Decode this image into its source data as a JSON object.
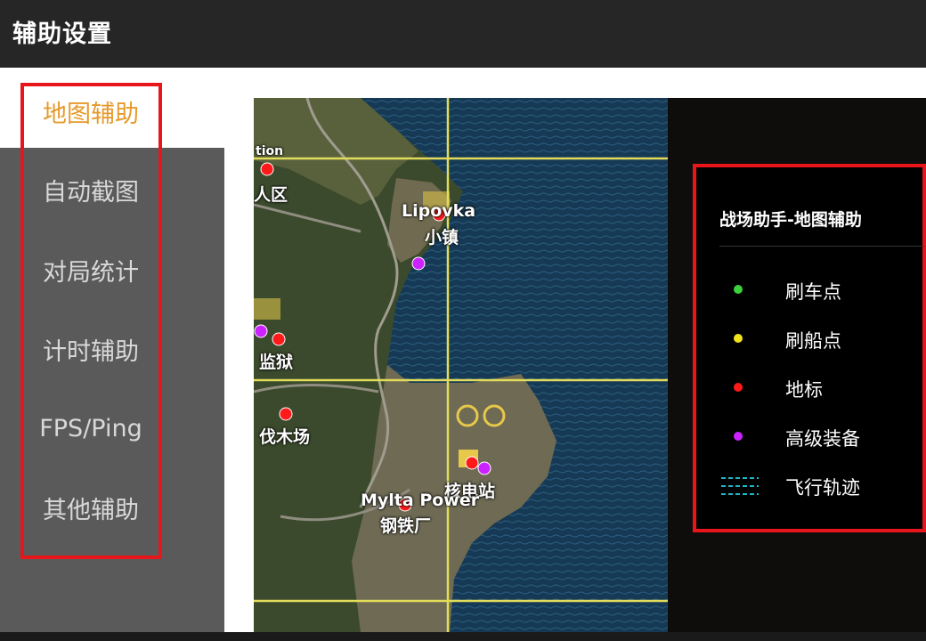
{
  "window": {
    "title": "辅助设置"
  },
  "sidebar": {
    "items": [
      {
        "label": "地图辅助",
        "active": true
      },
      {
        "label": "自动截图",
        "active": false
      },
      {
        "label": "对局统计",
        "active": false
      },
      {
        "label": "计时辅助",
        "active": false
      },
      {
        "label": "FPS/Ping",
        "active": false
      },
      {
        "label": "其他辅助",
        "active": false
      }
    ]
  },
  "map": {
    "labels": {
      "top_left_partial": "tion",
      "residential": "人区",
      "lipovka": "Lipovka",
      "village": "小镇",
      "prison": "监狱",
      "lumber": "伐木场",
      "nuclear": "核电站",
      "mylta_power": "Mylta Power",
      "steel": "钢铁厂"
    }
  },
  "legend": {
    "title": "战场助手-地图辅助",
    "items": [
      {
        "label": "刷车点",
        "color": "#3ad13a",
        "icon": "green-dot-icon"
      },
      {
        "label": "刷船点",
        "color": "#f2e21a",
        "icon": "yellow-dot-icon"
      },
      {
        "label": "地标",
        "color": "#ff1a1a",
        "icon": "red-dot-icon"
      },
      {
        "label": "高级装备",
        "color": "#cc22ff",
        "icon": "purple-dot-icon"
      },
      {
        "label": "飞行轨迹",
        "color": "#1fb6c8",
        "icon": "dashed-line-icon"
      }
    ]
  },
  "colors": {
    "accent": "#e69a2c",
    "highlight_border": "#e8151b",
    "titlebar": "#262626",
    "sidebar": "#5a5a5a"
  }
}
